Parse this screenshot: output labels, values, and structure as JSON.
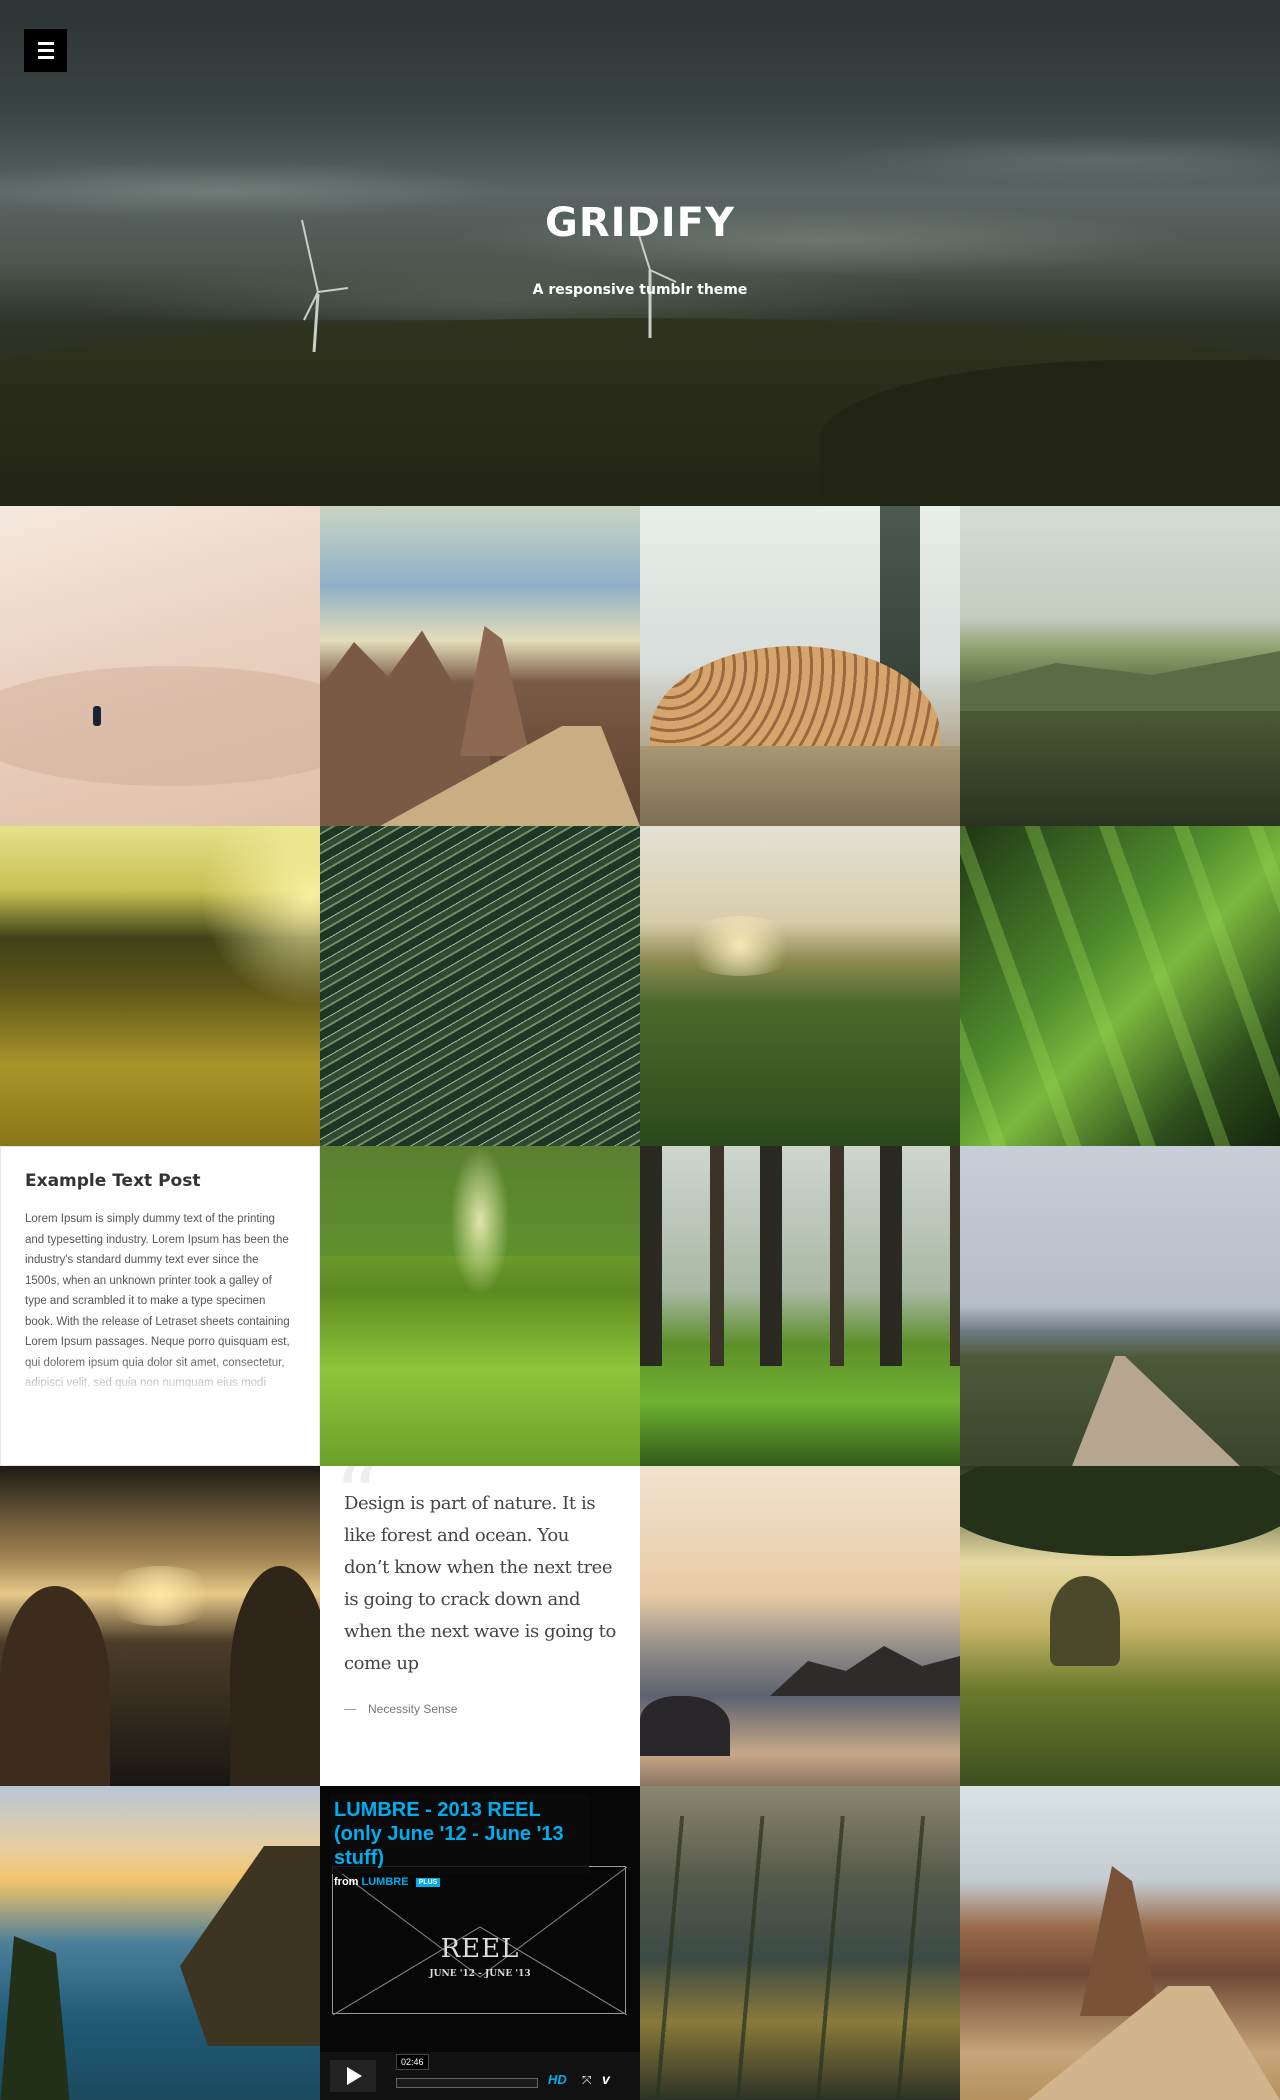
{
  "header": {
    "menu_icon": "hamburger-menu-icon",
    "title": "GRIDIFY",
    "description": "A responsive tumblr theme"
  },
  "text_post": {
    "title": "Example Text Post",
    "body": "Lorem Ipsum is simply dummy text of the printing and typesetting industry. Lorem Ipsum has been the industry's standard dummy text ever since the 1500s, when an unknown printer took a galley of type and scrambled it to make a type specimen book. With the release of Letraset sheets containing Lorem Ipsum passages. Neque porro quisquam est, qui dolorem ipsum quia dolor sit amet, consectetur, adipisci velit, sed quia non numquam eius modi tempora incidunt ut labore et"
  },
  "quote_post": {
    "text": "Design is part of nature. It is like forest and ocean. You don’t know when the next tree is going to crack down and when the next wave is going to come up",
    "source": "Necessity Sense"
  },
  "video_post": {
    "title": "LUMBRE - 2013 REEL (only June '12 - June '13 stuff)",
    "from_label": "from",
    "channel": "LUMBRE",
    "badge": "PLUS",
    "reel_text": "REEL",
    "reel_dates": "JUNE '12 - JUNE '13",
    "duration": "02:46",
    "hd_label": "HD",
    "fullscreen_icon": "fullscreen-icon",
    "vimeo_logo": "v"
  },
  "colors": {
    "accent": "#00adef",
    "menu_bg": "#000000"
  },
  "photos": [
    "desert-dunes",
    "rock-canyon-road",
    "log-pile-fog",
    "coastal-cliff",
    "golden-field",
    "grass-blades",
    "sunset-meadow",
    "green-leaves",
    "sunlit-lawn",
    "forest-shadows",
    "dirt-road",
    "cockpit-pilots",
    "beach-rocks",
    "oak-tree-meadow",
    "coast-sunset",
    "wild-flowers",
    "canyon-road"
  ]
}
